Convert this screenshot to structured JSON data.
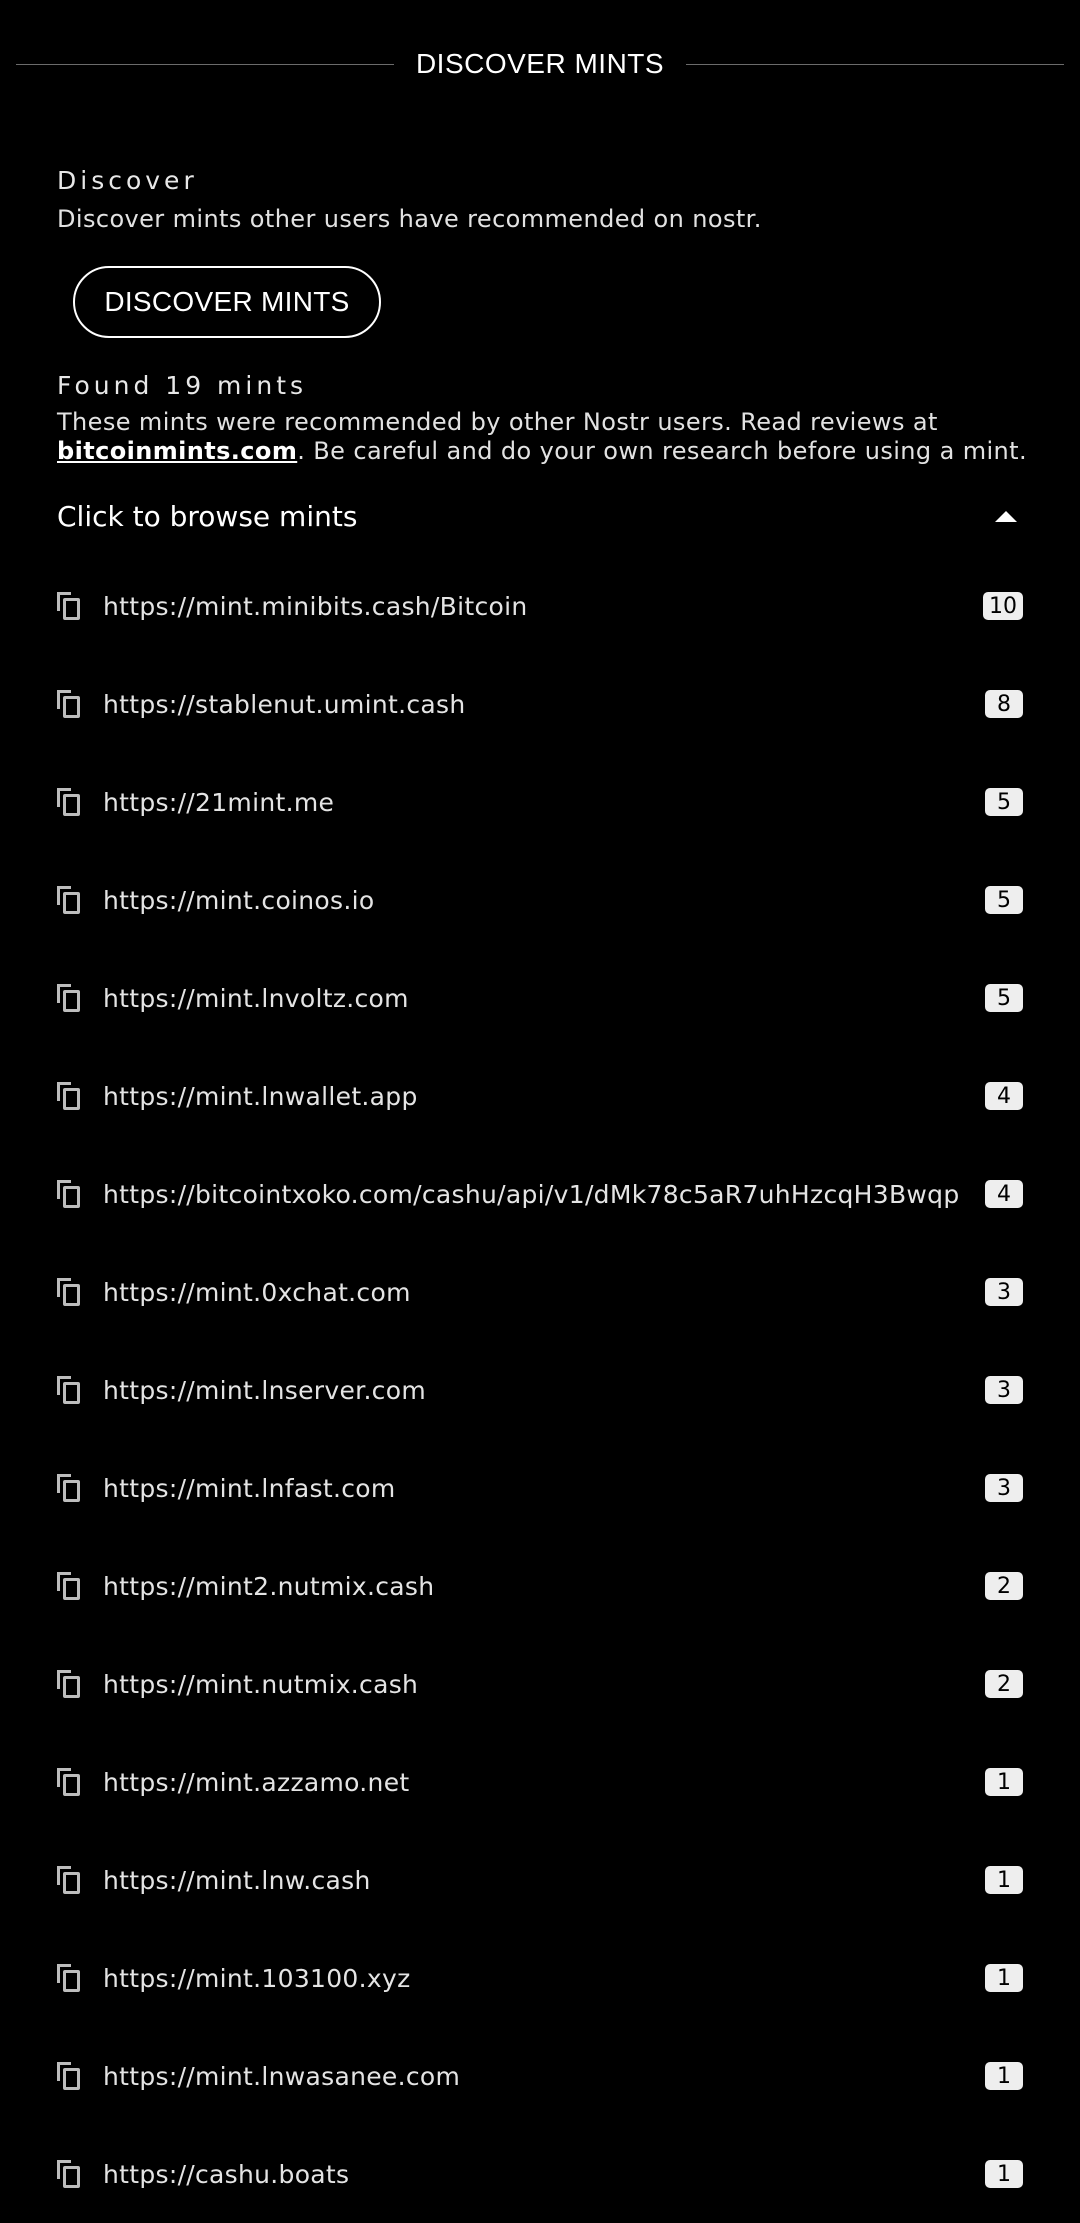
{
  "header": {
    "title": "DISCOVER MINTS"
  },
  "discover": {
    "heading": "Discover",
    "description": "Discover mints other users have recommended on nostr.",
    "button_label": "DISCOVER MINTS"
  },
  "results": {
    "heading": "Found 19 mints",
    "note_before": "These mints were recommended by other Nostr users. Read reviews at ",
    "link_text": "bitcoinmints.com",
    "note_after": ". Be careful and do your own research before using a mint."
  },
  "expander": {
    "label": "Click to browse mints",
    "icon": "caret-up-icon"
  },
  "mints": [
    {
      "url": "https://mint.minibits.cash/Bitcoin",
      "count": "10"
    },
    {
      "url": "https://stablenut.umint.cash",
      "count": "8"
    },
    {
      "url": "https://21mint.me",
      "count": "5"
    },
    {
      "url": "https://mint.coinos.io",
      "count": "5"
    },
    {
      "url": "https://mint.lnvoltz.com",
      "count": "5"
    },
    {
      "url": "https://mint.lnwallet.app",
      "count": "4"
    },
    {
      "url": "https://bitcointxoko.com/cashu/api/v1/dMk78c5aR7uhHzcqH3Bwqp",
      "count": "4"
    },
    {
      "url": "https://mint.0xchat.com",
      "count": "3"
    },
    {
      "url": "https://mint.lnserver.com",
      "count": "3"
    },
    {
      "url": "https://mint.lnfast.com",
      "count": "3"
    },
    {
      "url": "https://mint2.nutmix.cash",
      "count": "2"
    },
    {
      "url": "https://mint.nutmix.cash",
      "count": "2"
    },
    {
      "url": "https://mint.azzamo.net",
      "count": "1"
    },
    {
      "url": "https://mint.lnw.cash",
      "count": "1"
    },
    {
      "url": "https://mint.103100.xyz",
      "count": "1"
    },
    {
      "url": "https://mint.lnwasanee.com",
      "count": "1"
    },
    {
      "url": "https://cashu.boats",
      "count": "1"
    }
  ],
  "colors": {
    "background": "#000000",
    "text": "#ffffff",
    "badge_bg": "#eeeeee",
    "badge_text": "#000000"
  }
}
